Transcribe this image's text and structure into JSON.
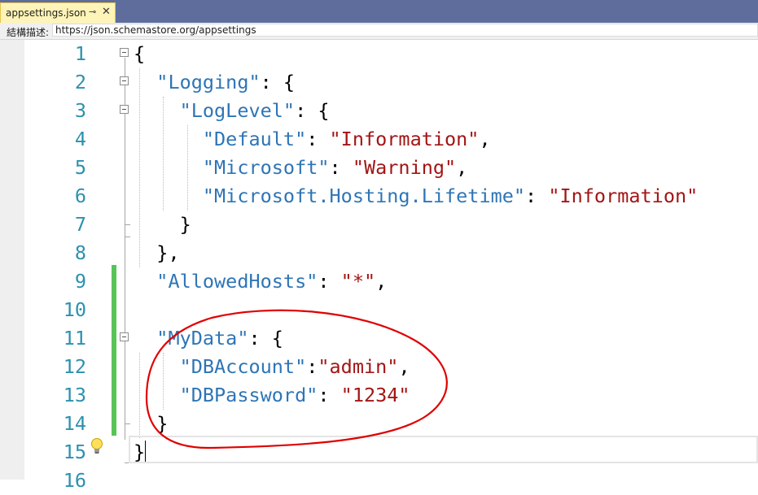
{
  "tab": {
    "title": "appsettings.json",
    "pin_glyph": "⊸",
    "close_glyph": "✕"
  },
  "schema": {
    "label": "結構描述:",
    "url": "https://json.schemastore.org/appsettings"
  },
  "editor": {
    "lines": [
      {
        "num": "1",
        "tokens": [
          {
            "t": "{",
            "c": "punct"
          }
        ]
      },
      {
        "num": "2",
        "tokens": [
          {
            "t": "  ",
            "c": "punct"
          },
          {
            "t": "\"Logging\"",
            "c": "key"
          },
          {
            "t": ": {",
            "c": "punct"
          }
        ]
      },
      {
        "num": "3",
        "tokens": [
          {
            "t": "    ",
            "c": "punct"
          },
          {
            "t": "\"LogLevel\"",
            "c": "key"
          },
          {
            "t": ": {",
            "c": "punct"
          }
        ]
      },
      {
        "num": "4",
        "tokens": [
          {
            "t": "      ",
            "c": "punct"
          },
          {
            "t": "\"Default\"",
            "c": "key"
          },
          {
            "t": ": ",
            "c": "punct"
          },
          {
            "t": "\"Information\"",
            "c": "str"
          },
          {
            "t": ",",
            "c": "punct"
          }
        ]
      },
      {
        "num": "5",
        "tokens": [
          {
            "t": "      ",
            "c": "punct"
          },
          {
            "t": "\"Microsoft\"",
            "c": "key"
          },
          {
            "t": ": ",
            "c": "punct"
          },
          {
            "t": "\"Warning\"",
            "c": "str"
          },
          {
            "t": ",",
            "c": "punct"
          }
        ]
      },
      {
        "num": "6",
        "tokens": [
          {
            "t": "      ",
            "c": "punct"
          },
          {
            "t": "\"Microsoft.Hosting.Lifetime\"",
            "c": "key"
          },
          {
            "t": ": ",
            "c": "punct"
          },
          {
            "t": "\"Information\"",
            "c": "str"
          }
        ]
      },
      {
        "num": "7",
        "tokens": [
          {
            "t": "    }",
            "c": "punct"
          }
        ]
      },
      {
        "num": "8",
        "tokens": [
          {
            "t": "  },",
            "c": "punct"
          }
        ]
      },
      {
        "num": "9",
        "tokens": [
          {
            "t": "  ",
            "c": "punct"
          },
          {
            "t": "\"AllowedHosts\"",
            "c": "key"
          },
          {
            "t": ": ",
            "c": "punct"
          },
          {
            "t": "\"*\"",
            "c": "str"
          },
          {
            "t": ",",
            "c": "punct"
          }
        ]
      },
      {
        "num": "10",
        "tokens": []
      },
      {
        "num": "11",
        "tokens": [
          {
            "t": "  ",
            "c": "punct"
          },
          {
            "t": "\"MyData\"",
            "c": "key"
          },
          {
            "t": ": {",
            "c": "punct"
          }
        ]
      },
      {
        "num": "12",
        "tokens": [
          {
            "t": "    ",
            "c": "punct"
          },
          {
            "t": "\"DBAccount\"",
            "c": "key"
          },
          {
            "t": ":",
            "c": "punct"
          },
          {
            "t": "\"admin\"",
            "c": "str"
          },
          {
            "t": ",",
            "c": "punct"
          }
        ]
      },
      {
        "num": "13",
        "tokens": [
          {
            "t": "    ",
            "c": "punct"
          },
          {
            "t": "\"DBPassword\"",
            "c": "key"
          },
          {
            "t": ": ",
            "c": "punct"
          },
          {
            "t": "\"1234\"",
            "c": "str"
          }
        ]
      },
      {
        "num": "14",
        "tokens": [
          {
            "t": "  }",
            "c": "punct"
          }
        ]
      },
      {
        "num": "15",
        "tokens": [
          {
            "t": "}",
            "c": "punct"
          }
        ]
      },
      {
        "num": "16",
        "tokens": []
      }
    ],
    "changed_lines": [
      "9",
      "10",
      "11",
      "12",
      "13",
      "14"
    ],
    "current_line": "15"
  },
  "colors": {
    "tab_strip": "#5e6d9c",
    "active_tab": "#fff4b8",
    "json_key": "#2e75b6",
    "json_string": "#a31515",
    "line_number": "#2b91af",
    "change_bar": "#57c457",
    "annotation": "#e00000"
  },
  "icons": {
    "lightbulb": "lightbulb-icon",
    "fold": "collapse-box-icon"
  }
}
